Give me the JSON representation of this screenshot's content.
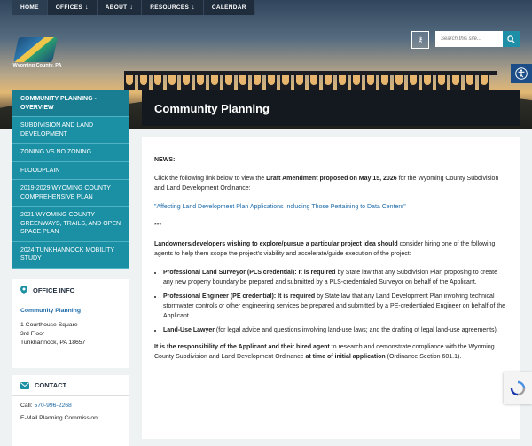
{
  "nav": {
    "items": [
      {
        "label": "HOME",
        "has_dropdown": false
      },
      {
        "label": "OFFICES",
        "has_dropdown": true
      },
      {
        "label": "ABOUT",
        "has_dropdown": true
      },
      {
        "label": "RESOURCES",
        "has_dropdown": true
      },
      {
        "label": "CALENDAR",
        "has_dropdown": false
      }
    ]
  },
  "logo": {
    "text": "Wyoming County, PA"
  },
  "search": {
    "placeholder": "Search this site..."
  },
  "sidebar": {
    "menu": [
      {
        "label": "Community Planning - Overview",
        "active": true
      },
      {
        "label": "Subdivision and Land Development"
      },
      {
        "label": "Zoning vs No Zoning"
      },
      {
        "label": "Floodplain"
      },
      {
        "label": "2019-2029 Wyoming County Comprehensive Plan"
      },
      {
        "label": "2021 Wyoming County Greenways, Trails, and Open Space Plan"
      },
      {
        "label": "2024 Tunkhannock Mobility Study"
      }
    ],
    "office_info": {
      "heading": "OFFICE INFO",
      "name": "Community Planning",
      "address": [
        "1 Courthouse Square",
        "3rd Floor",
        "Tunkhannock, PA 18657"
      ]
    },
    "contact": {
      "heading": "CONTACT",
      "call_label": "Call:",
      "phone": "570-996-2268",
      "email_label": "E-Mail Planning Commission:"
    }
  },
  "main": {
    "title": "Community Planning",
    "news_label": "NEWS:",
    "p1_pre": "Click the following link below to view the ",
    "p1_bold": "Draft Amendment proposed on May 15, 2026",
    "p1_post": " for the Wyoming County Subdivision and Land Development Ordinance:",
    "link": "\"Affecting Land Development Plan Applications Including Those Pertaining to Data Centers\"",
    "separator": "***",
    "p2_bold": "Landowners/developers wishing to explore/pursue a particular project idea should",
    "p2_rest": " consider hiring one of the following agents to help them scope the project's viability and accelerate/guide execution of the project:",
    "bullets": [
      {
        "bold": "Professional Land Surveyor (PLS credential): It is required",
        "rest": " by State law that any Subdivision Plan proposing to create any new property boundary be prepared and submitted by a PLS-credentialed Surveyor on behalf of the Applicant."
      },
      {
        "bold": "Professional Engineer (PE credential): It is required",
        "rest": " by State law that any Land Development Plan involving technical stormwater controls or other engineering services be prepared and submitted by a PE-credentialed Engineer on behalf of the Applicant."
      },
      {
        "bold": "Land-Use Lawyer",
        "rest": " (for legal advice and questions involving land-use laws; and the drafting of legal land-use agreements)."
      }
    ],
    "p3_bold1": "It is the responsibility of the Applicant and their hired agent",
    "p3_mid": " to research and demonstrate compliance with the Wyoming County Subdivision and Land Development Ordinance ",
    "p3_bold2": "at time of initial application",
    "p3_end": " (Ordinance Section 601.1)."
  }
}
